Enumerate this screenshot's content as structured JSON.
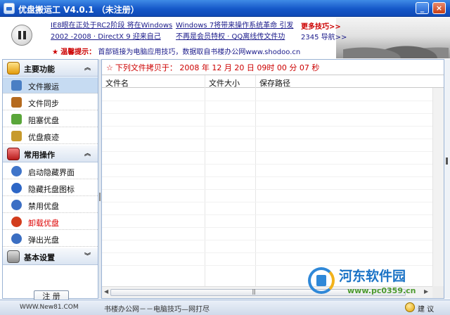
{
  "window": {
    "title": "优盘搬运工 V4.0.1   （未注册）",
    "min_label": "_",
    "close_label": "×"
  },
  "banner": {
    "news": [
      "IE8眼在正处于RC2阶段 将在Windows",
      "2002 -2008 · DirectX 9 迎来自己",
      "Windows 7将带来操作系统革命 引发",
      "不再是会员特权 · QQ离线传文件功"
    ],
    "more_tips": "更多技巧>>",
    "nav_2345": "2345 导航>>",
    "notice_star": "★",
    "notice_head": "温馨提示：",
    "notice_body": "首部链接为电脑应用技巧，数据取自书楼办公网www.shodoo.cn"
  },
  "sidebar": {
    "groups": [
      {
        "label": "主要功能",
        "chevron": "︽",
        "items": [
          {
            "label": "文件搬运",
            "icon": "truck-icon"
          },
          {
            "label": "文件同步",
            "icon": "briefcase-icon"
          },
          {
            "label": "阻塞优盘",
            "icon": "lock-icon"
          },
          {
            "label": "优盘痕迹",
            "icon": "broom-icon"
          }
        ]
      },
      {
        "label": "常用操作",
        "chevron": "︽",
        "items": [
          {
            "label": "启动隐藏界面",
            "icon": "power-icon"
          },
          {
            "label": "隐藏托盘图标",
            "icon": "info-icon"
          },
          {
            "label": "禁用优盘",
            "icon": "forbid-icon"
          },
          {
            "label": "卸载优盘",
            "icon": "eject-red-icon"
          },
          {
            "label": "弹出光盘",
            "icon": "eject-icon"
          }
        ]
      },
      {
        "label": "基本设置",
        "chevron": "︾",
        "items": []
      }
    ],
    "register_label": "注 册"
  },
  "main": {
    "copy_status_star": "☆",
    "copy_status": "下列文件拷贝于： 2008 年 12 月 20 日 09时 00 分 07 秒",
    "columns": [
      "文件名",
      "文件大小",
      "保存路径"
    ]
  },
  "statusbar": {
    "site": "WWW.New81.COM",
    "message": "书楼办公网－－电脑技巧—网打尽",
    "feedback": "建 议"
  },
  "watermark": {
    "name": "河东软件园",
    "url": "www.pc0359.cn"
  },
  "colors": {
    "title_bar": "#1557c8",
    "accent_red": "#cc0000",
    "selection": "#c6dbf2",
    "border": "#9bb3d4"
  }
}
